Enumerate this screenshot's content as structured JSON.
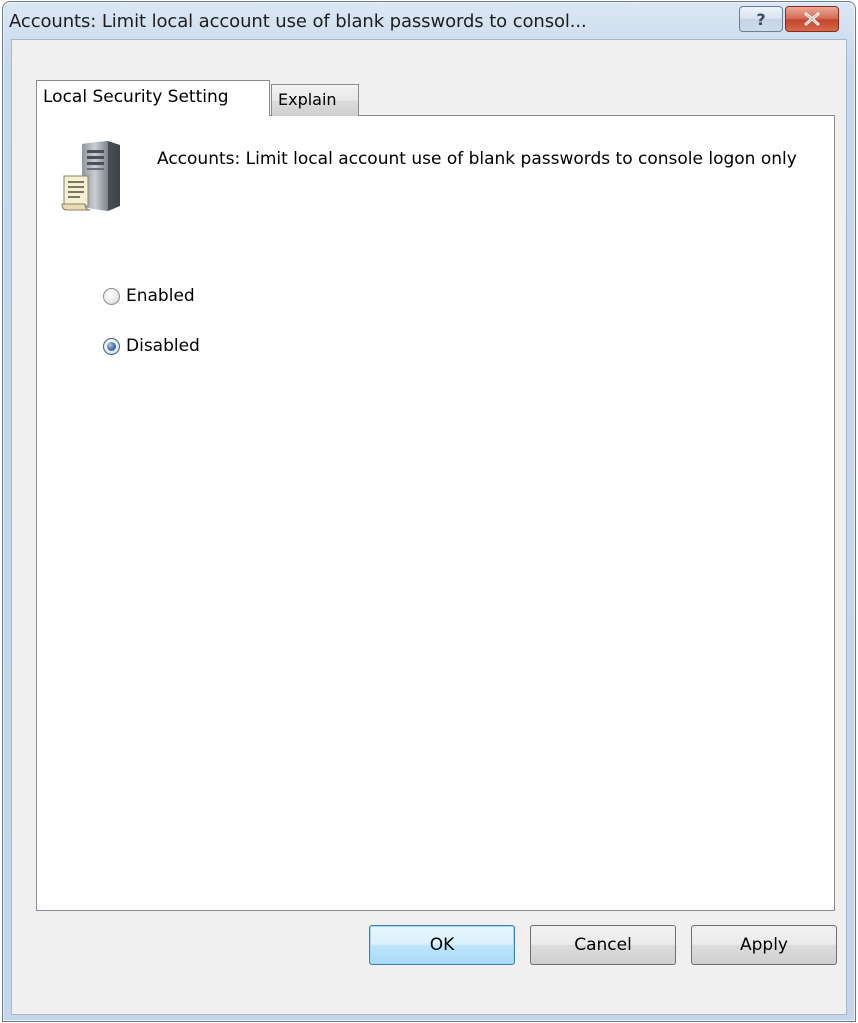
{
  "window": {
    "title": "Accounts: Limit local account use of blank passwords to consol...",
    "help_label": "?",
    "close_icon": "close-icon"
  },
  "tabs": [
    {
      "label": "Local Security Setting",
      "active": true
    },
    {
      "label": "Explain",
      "active": false
    }
  ],
  "policy": {
    "icon": "server-document-icon",
    "description": "Accounts: Limit local account use of blank passwords to console logon only"
  },
  "options": {
    "enabled_label": "Enabled",
    "disabled_label": "Disabled",
    "selected": "Disabled"
  },
  "buttons": {
    "ok_label": "OK",
    "cancel_label": "Cancel",
    "apply_label": "Apply"
  },
  "colors": {
    "titlebar": "#cfdeee",
    "close_button": "#c4452c",
    "default_button": "#bee6fd",
    "radio_selected": "#3f6fb4"
  }
}
